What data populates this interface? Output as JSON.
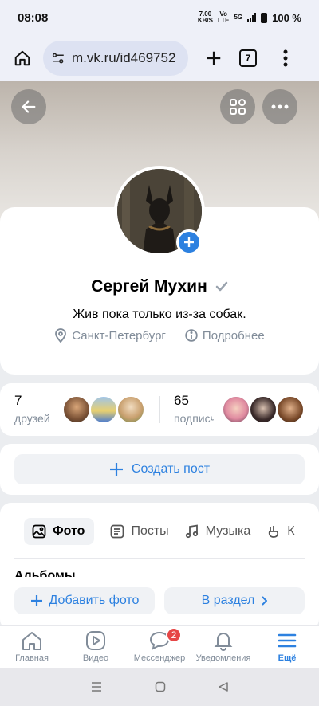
{
  "status_bar": {
    "time": "08:08",
    "speed": "7.00",
    "speed_unit": "KB/S",
    "net1": "Vo",
    "net2": "LTE",
    "net_5g": "5G",
    "battery": "100 %"
  },
  "browser": {
    "url": "m.vk.ru/id469752",
    "tab_count": "7"
  },
  "profile": {
    "name": "Сергей Мухин",
    "status": "Жив пока только из-за собак.",
    "city": "Санкт-Петербург",
    "more": "Подробнее"
  },
  "stats": {
    "friends_count": "7",
    "friends_label": "друзей",
    "followers_count": "65",
    "followers_label": "подписчиков"
  },
  "create_post": {
    "label": "Создать пост"
  },
  "tabs": [
    {
      "label": "Фото",
      "icon": "photo-icon"
    },
    {
      "label": "Посты",
      "icon": "posts-icon"
    },
    {
      "label": "Музыка",
      "icon": "music-icon"
    },
    {
      "label": "К",
      "icon": "clips-icon"
    }
  ],
  "section": {
    "title": "Альбомы"
  },
  "actions": {
    "add_photo": "Добавить фото",
    "to_section": "В раздел"
  },
  "bottom_nav": [
    {
      "label": "Главная",
      "icon": "home-icon"
    },
    {
      "label": "Видео",
      "icon": "video-icon"
    },
    {
      "label": "Мессенджер",
      "icon": "messenger-icon",
      "badge": "2"
    },
    {
      "label": "Уведомления",
      "icon": "bell-icon"
    },
    {
      "label": "Ещё",
      "icon": "menu-icon"
    }
  ],
  "colors": {
    "accent": "#2d81e0",
    "secondary_text": "#818c99",
    "badge": "#e64646"
  }
}
